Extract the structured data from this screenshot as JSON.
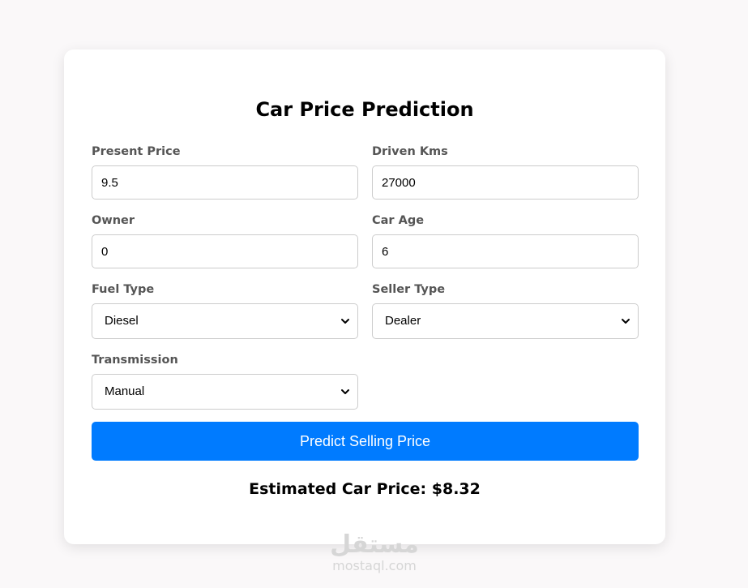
{
  "form": {
    "title": "Car Price Prediction",
    "fields": {
      "present_price": {
        "label": "Present Price",
        "value": "9.5"
      },
      "driven_kms": {
        "label": "Driven Kms",
        "value": "27000"
      },
      "owner": {
        "label": "Owner",
        "value": "0"
      },
      "car_age": {
        "label": "Car Age",
        "value": "6"
      },
      "fuel_type": {
        "label": "Fuel Type",
        "selected": "Diesel"
      },
      "seller_type": {
        "label": "Seller Type",
        "selected": "Dealer"
      },
      "transmission": {
        "label": "Transmission",
        "selected": "Manual"
      }
    },
    "submit_label": "Predict Selling Price",
    "result_text": "Estimated Car Price: $8.32"
  },
  "watermark": {
    "logo_text": "مستقل",
    "site": "mostaql.com"
  },
  "colors": {
    "background": "#faf8f9",
    "card": "#ffffff",
    "accent": "#007bff",
    "label": "#555555",
    "border": "#cccccc"
  }
}
